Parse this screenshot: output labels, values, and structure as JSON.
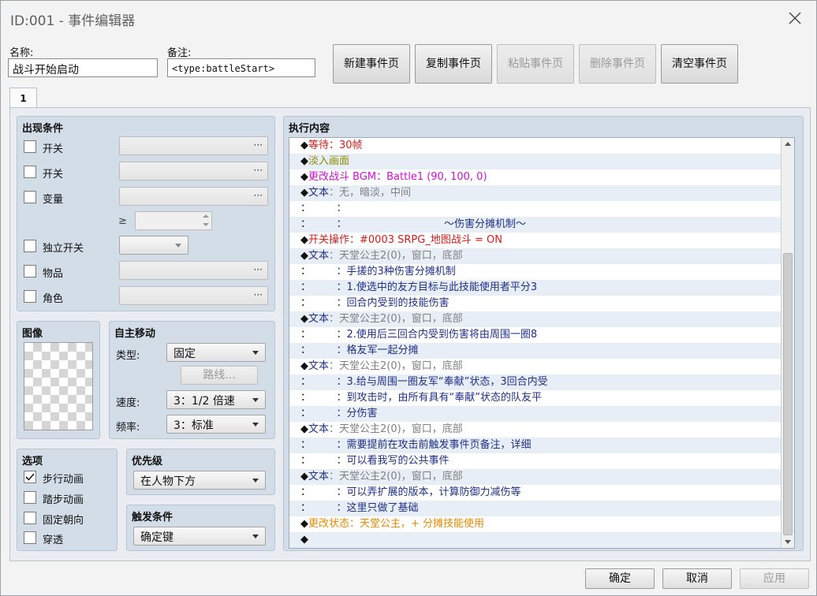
{
  "window": {
    "title": "ID:001 - 事件编辑器"
  },
  "header": {
    "name_label": "名称:",
    "name_value": "战斗开始启动",
    "note_label": "备注:",
    "note_value": "<type:battleStart>",
    "buttons": {
      "new_page": "新建事件页",
      "copy_page": "复制事件页",
      "paste_page": "粘贴事件页",
      "delete_page": "删除事件页",
      "clear_page": "清空事件页"
    }
  },
  "tabs": [
    {
      "label": "1",
      "selected": true
    }
  ],
  "conditions": {
    "title": "出现条件",
    "switch1_label": "开关",
    "switch2_label": "开关",
    "variable_label": "变量",
    "variable_op": "≥",
    "self_switch_label": "独立开关",
    "item_label": "物品",
    "actor_label": "角色",
    "more_glyph": "···"
  },
  "image_panel": {
    "title": "图像"
  },
  "autonomous_movement": {
    "title": "自主移动",
    "type_label": "类型:",
    "type_value": "固定",
    "route_button": "路线...",
    "speed_label": "速度:",
    "speed_value": "3：1/2 倍速",
    "frequency_label": "频率:",
    "frequency_value": "3：标准"
  },
  "options": {
    "title": "选项",
    "walking_anim": {
      "label": "步行动画",
      "checked": true
    },
    "stepping_anim": {
      "label": "踏步动画",
      "checked": false
    },
    "direction_fix": {
      "label": "固定朝向",
      "checked": false
    },
    "through": {
      "label": "穿透",
      "checked": false
    }
  },
  "priority": {
    "title": "优先级",
    "value": "在人物下方"
  },
  "trigger": {
    "title": "触发条件",
    "value": "确定键"
  },
  "contents": {
    "title": "执行内容",
    "rows": [
      {
        "bullet": "◆",
        "cmd": "等待：",
        "rest": "30帧",
        "cmd_color": "#d81b1b",
        "rest_color": "#d81b1b"
      },
      {
        "bullet": "◆",
        "cmd": "淡入画面",
        "rest": "",
        "cmd_color": "#8a8a00",
        "rest_color": "#8a8a00"
      },
      {
        "bullet": "◆",
        "cmd": "更改战斗 BGM：",
        "rest": "Battle1 (90, 100, 0)",
        "cmd_color": "#d010d0",
        "rest_color": "#d010d0"
      },
      {
        "bullet": "◆",
        "cmd": "文本",
        "rest": "：无，暗淡，中间",
        "cmd_color": "#1f2f8a",
        "rest_color": "#808080"
      },
      {
        "bullet": "：",
        "cmd": "",
        "rest": "　　　：",
        "cmd_color": "#1f2f8a",
        "rest_color": "#1f2f8a"
      },
      {
        "bullet": "：",
        "cmd": "",
        "rest": "　　　：　　　　　　　　　　～伤害分摊机制～",
        "cmd_color": "#1f2f8a",
        "rest_color": "#1f2f8a"
      },
      {
        "bullet": "◆",
        "cmd": "开关操作：",
        "rest": "#0003 SRPG_地图战斗 = ON",
        "cmd_color": "#d81b1b",
        "rest_color": "#d81b1b"
      },
      {
        "bullet": "◆",
        "cmd": "文本",
        "rest": "：天堂公主2(0)，窗口，底部",
        "cmd_color": "#1f2f8a",
        "rest_color": "#808080"
      },
      {
        "bullet": "：",
        "cmd": "",
        "rest": "　　　：手搓的3种伤害分摊机制",
        "cmd_color": "#1f2f8a",
        "rest_color": "#1f2f8a"
      },
      {
        "bullet": "：",
        "cmd": "",
        "rest": "　　　：1.使选中的友方目标与此技能使用者平分3",
        "cmd_color": "#1f2f8a",
        "rest_color": "#1f2f8a"
      },
      {
        "bullet": "：",
        "cmd": "",
        "rest": "　　　：回合内受到的技能伤害",
        "cmd_color": "#1f2f8a",
        "rest_color": "#1f2f8a"
      },
      {
        "bullet": "◆",
        "cmd": "文本",
        "rest": "：天堂公主2(0)，窗口，底部",
        "cmd_color": "#1f2f8a",
        "rest_color": "#808080"
      },
      {
        "bullet": "：",
        "cmd": "",
        "rest": "　　　：2.使用后三回合内受到伤害将由周围一圈8",
        "cmd_color": "#1f2f8a",
        "rest_color": "#1f2f8a"
      },
      {
        "bullet": "：",
        "cmd": "",
        "rest": "　　　：格友军一起分摊",
        "cmd_color": "#1f2f8a",
        "rest_color": "#1f2f8a"
      },
      {
        "bullet": "◆",
        "cmd": "文本",
        "rest": "：天堂公主2(0)，窗口，底部",
        "cmd_color": "#1f2f8a",
        "rest_color": "#808080"
      },
      {
        "bullet": "：",
        "cmd": "",
        "rest": "　　　：3.给与周围一圈友军“奉献”状态，3回合内受",
        "cmd_color": "#1f2f8a",
        "rest_color": "#1f2f8a"
      },
      {
        "bullet": "：",
        "cmd": "",
        "rest": "　　　：到攻击时，由所有具有“奉献”状态的队友平",
        "cmd_color": "#1f2f8a",
        "rest_color": "#1f2f8a"
      },
      {
        "bullet": "：",
        "cmd": "",
        "rest": "　　　：分伤害",
        "cmd_color": "#1f2f8a",
        "rest_color": "#1f2f8a"
      },
      {
        "bullet": "◆",
        "cmd": "文本",
        "rest": "：天堂公主2(0)，窗口，底部",
        "cmd_color": "#1f2f8a",
        "rest_color": "#808080"
      },
      {
        "bullet": "：",
        "cmd": "",
        "rest": "　　　：需要提前在攻击前触发事件页备注，详细",
        "cmd_color": "#1f2f8a",
        "rest_color": "#1f2f8a"
      },
      {
        "bullet": "：",
        "cmd": "",
        "rest": "　　　：可以看我写的公共事件",
        "cmd_color": "#1f2f8a",
        "rest_color": "#1f2f8a"
      },
      {
        "bullet": "◆",
        "cmd": "文本",
        "rest": "：天堂公主2(0)，窗口，底部",
        "cmd_color": "#1f2f8a",
        "rest_color": "#808080"
      },
      {
        "bullet": "：",
        "cmd": "",
        "rest": "　　　：可以弄扩展的版本，计算防御力减伤等",
        "cmd_color": "#1f2f8a",
        "rest_color": "#1f2f8a"
      },
      {
        "bullet": "：",
        "cmd": "",
        "rest": "　　　：这里只做了基础",
        "cmd_color": "#1f2f8a",
        "rest_color": "#1f2f8a"
      },
      {
        "bullet": "◆",
        "cmd": "更改状态：",
        "rest": "天堂公主，+ 分摊技能使用",
        "cmd_color": "#e88a00",
        "rest_color": "#e88a00"
      },
      {
        "bullet": "◆",
        "cmd": "",
        "rest": "",
        "cmd_color": "#1f2f8a",
        "rest_color": "#1f2f8a"
      }
    ]
  },
  "footer": {
    "ok": "确定",
    "cancel": "取消",
    "apply": "应用"
  }
}
